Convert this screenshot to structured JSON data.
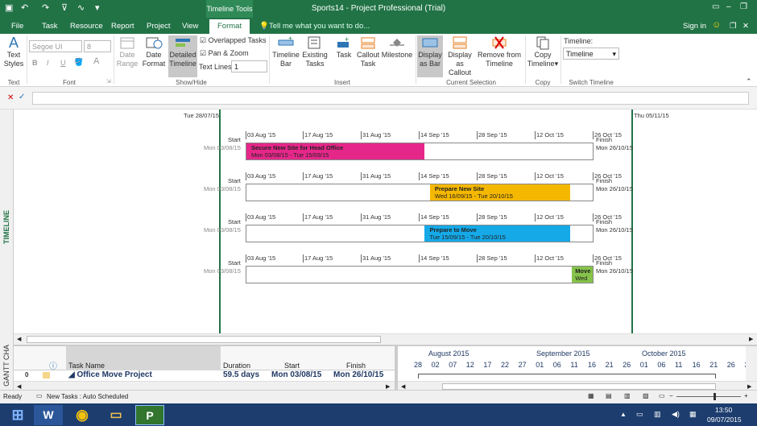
{
  "titlebar": {
    "title": "Sports14 - Project Professional (Trial)",
    "tools_label": "Timeline Tools"
  },
  "tabs": [
    "File",
    "Task",
    "Resource",
    "Report",
    "Project",
    "View",
    "Format"
  ],
  "search": {
    "placeholder": "Tell me what you want to do..."
  },
  "user": {
    "sign_in": "Sign in"
  },
  "ribbon": {
    "text_styles": "Text Styles",
    "font_name": "Segoe UI",
    "font_size": "8",
    "bold": "B",
    "italic": "I",
    "underline": "U",
    "date_range": "Date Range",
    "date_format": "Date Format",
    "detailed_timeline": "Detailed Timeline",
    "overlapped_tasks": "Overlapped Tasks",
    "pan_zoom": "Pan & Zoom",
    "text_lines_label": "Text Lines:",
    "text_lines_value": "1",
    "timeline_bar": "Timeline Bar",
    "existing_tasks": "Existing Tasks",
    "task": "Task",
    "callout_task": "Callout Task",
    "milestone": "Milestone",
    "display_as_bar": "Display as Bar",
    "display_as_callout": "Display as Callout",
    "remove_from_timeline": "Remove from Timeline",
    "copy_timeline": "Copy Timeline",
    "timeline_label": "Timeline:",
    "timeline_select": "Timeline",
    "groups": {
      "text": "Text",
      "font": "Font",
      "show_hide": "Show/Hide",
      "insert": "Insert",
      "current_selection": "Current Selection",
      "copy": "Copy",
      "switch_timeline": "Switch Timeline"
    }
  },
  "timeline": {
    "side_label": "TIMELINE",
    "range_start": "Tue 28/07/15",
    "range_end": "Thu 05/11/15",
    "ticks": [
      "03 Aug '15",
      "17 Aug '15",
      "31 Aug '15",
      "14 Sep '15",
      "28 Sep '15",
      "12 Oct '15",
      "26 Oct '15"
    ],
    "start_label": "Start",
    "finish_label": "Finish",
    "start_date": "Mon 03/08/15",
    "finish_date": "Mon 26/10/15",
    "bars": [
      {
        "name": "Secure New Site for Head Office",
        "dates": "Mon 03/08/15 - Tue 15/09/15",
        "color": "#e6278a"
      },
      {
        "name": "Prepare New Site",
        "dates": "Wed 16/09/15 - Tue 20/10/15",
        "color": "#f5b800"
      },
      {
        "name": "Prepare to Move",
        "dates": "Tue 15/09/15 - Tue 20/10/15",
        "color": "#15a9e8"
      },
      {
        "name": "Move",
        "dates": "Wed",
        "color": "#86c34a"
      }
    ]
  },
  "gantt": {
    "side_label": "GANTT CHA",
    "columns": [
      "Task Name",
      "Duration",
      "Start",
      "Finish"
    ],
    "row": {
      "id": "0",
      "name": "Office Move Project",
      "duration": "59.5 days",
      "start": "Mon 03/08/15",
      "finish": "Mon 26/10/15"
    },
    "months": [
      "August 2015",
      "September 2015",
      "October 2015",
      "No"
    ],
    "days": [
      "28",
      "02",
      "07",
      "12",
      "17",
      "22",
      "27",
      "01",
      "06",
      "11",
      "16",
      "21",
      "26",
      "01",
      "06",
      "11",
      "16",
      "21",
      "26",
      "31"
    ]
  },
  "status": {
    "ready": "Ready",
    "new_tasks": "New Tasks : Auto Scheduled"
  },
  "taskbar": {
    "time": "13:50",
    "date": "09/07/2015"
  }
}
